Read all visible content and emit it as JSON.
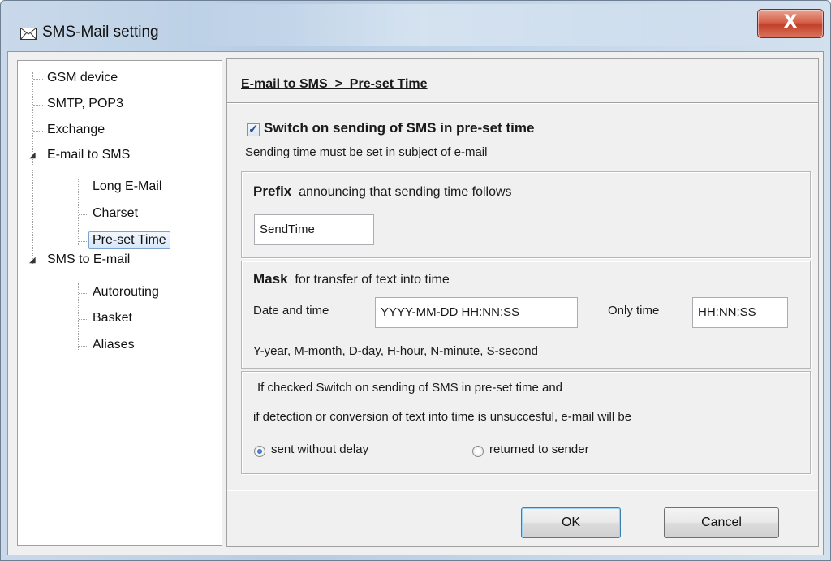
{
  "window": {
    "title": "SMS-Mail setting",
    "close_glyph": "X"
  },
  "tree": {
    "items": [
      {
        "label": "GSM device"
      },
      {
        "label": "SMTP, POP3"
      },
      {
        "label": "Exchange"
      },
      {
        "label": "E-mail to SMS"
      },
      {
        "label": "Long E-Mail"
      },
      {
        "label": "Charset"
      },
      {
        "label": "Pre-set Time"
      },
      {
        "label": "SMS to E-mail"
      },
      {
        "label": "Autorouting"
      },
      {
        "label": "Basket"
      },
      {
        "label": "Aliases"
      }
    ],
    "selected": "Pre-set Time"
  },
  "panel": {
    "breadcrumb": "E-mail to SMS  >  Pre-set Time",
    "switch_checked": true,
    "switch_label": "Switch on sending of SMS in pre-set time",
    "switch_note": "Sending time must be set in subject of e-mail",
    "prefix": {
      "title_bold": "Prefix",
      "title_rest": "announcing that sending time follows",
      "value": "SendTime"
    },
    "mask": {
      "title_bold": "Mask",
      "title_rest": "for transfer of text into time",
      "date_time_label": "Date and time",
      "date_time_value": "YYYY-MM-DD HH:NN:SS",
      "only_time_label": "Only time",
      "only_time_value": "HH:NN:SS",
      "legend": "Y-year, M-month, D-day, H-hour, N-minute, S-second"
    },
    "fallback": {
      "line1": "If checked Switch on sending of SMS in pre-set time and",
      "line2": "if detection or conversion of text into time is unsuccesful, e-mail will be",
      "option_1": "sent without delay",
      "option_2": "returned to sender",
      "selected": "sent without delay"
    }
  },
  "buttons": {
    "ok": "OK",
    "cancel": "Cancel"
  },
  "colors": {
    "close_button": "#c9452e",
    "selection": "#d6e6f8",
    "dialog_bg": "#f0f0f0"
  }
}
